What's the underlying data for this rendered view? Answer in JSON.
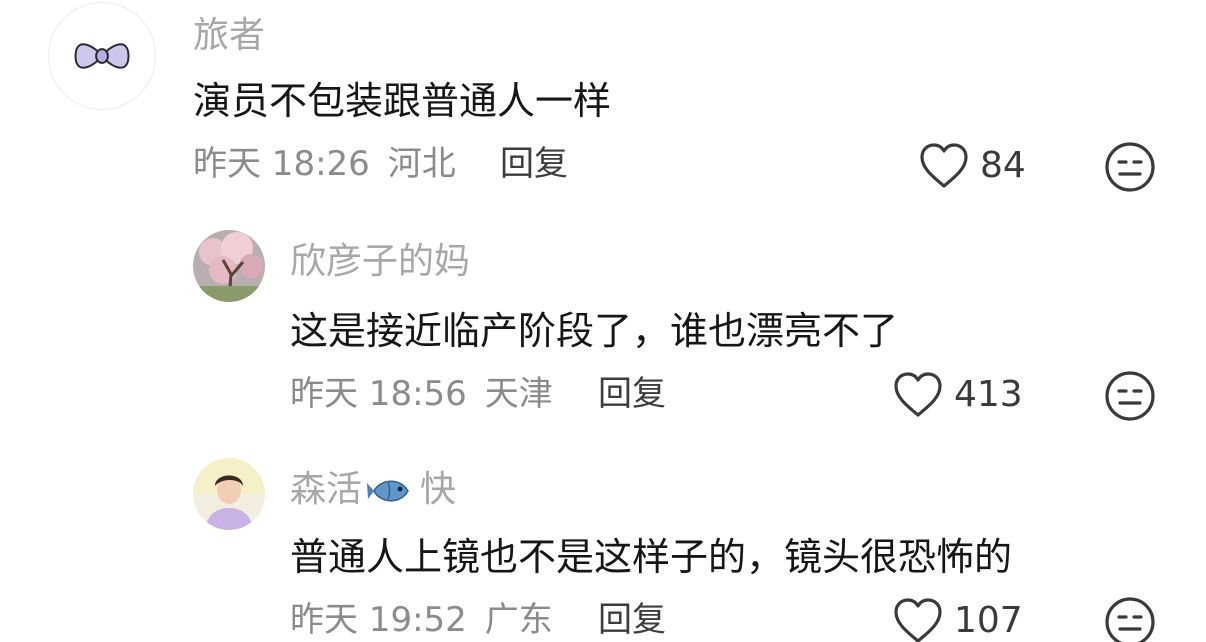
{
  "comments": [
    {
      "avatar_icon": "bow-avatar-icon",
      "username": "旅者",
      "content": "演员不包装跟普通人一样",
      "time": "昨天 18:26",
      "location": "河北",
      "reply_label": "回复",
      "likes": "84"
    },
    {
      "avatar_icon": "cherry-blossom-avatar",
      "username": "欣彦子的妈",
      "content": "这是接近临产阶段了，谁也漂亮不了",
      "time": "昨天 18:56",
      "location": "天津",
      "reply_label": "回复",
      "likes": "413"
    },
    {
      "avatar_icon": "person-avatar",
      "username_before": "森活",
      "username_emoji": "fish-emoji-icon",
      "username_after": "快",
      "content": "普通人上镜也不是这样子的，镜头很恐怖的",
      "time": "昨天 19:52",
      "location": "广东",
      "reply_label": "回复",
      "likes": "107"
    }
  ],
  "colors": {
    "username": "#a7a7a7",
    "content": "#161616",
    "meta": "#8b8b8b",
    "icon": "#3a3a3a"
  }
}
